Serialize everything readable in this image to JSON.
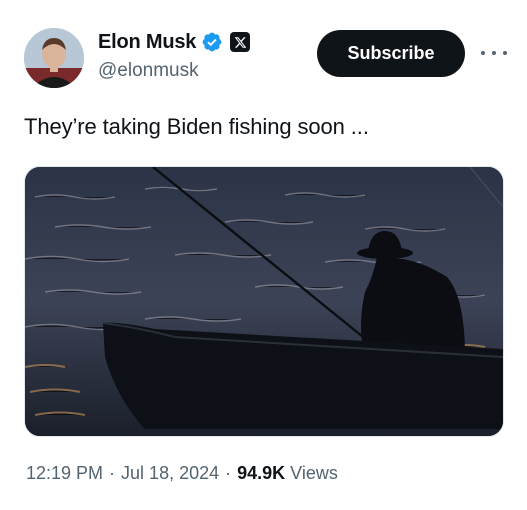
{
  "author": {
    "display_name": "Elon Musk",
    "handle": "@elonmusk",
    "verified_color": "#1d9bf0",
    "avatar_icon": "profile-photo"
  },
  "actions": {
    "subscribe_label": "Subscribe",
    "more_icon": "more-horizontal-icon"
  },
  "tweet": {
    "text": "They’re taking Biden fishing soon ...",
    "media_description_icon": "photo"
  },
  "meta": {
    "time": "12:19 PM",
    "separator": "·",
    "date": "Jul 18, 2024",
    "views_count": "94.9K",
    "views_label": "Views"
  },
  "colors": {
    "text_primary": "#0f1419",
    "text_secondary": "#536471",
    "button_bg": "#0f1419"
  }
}
